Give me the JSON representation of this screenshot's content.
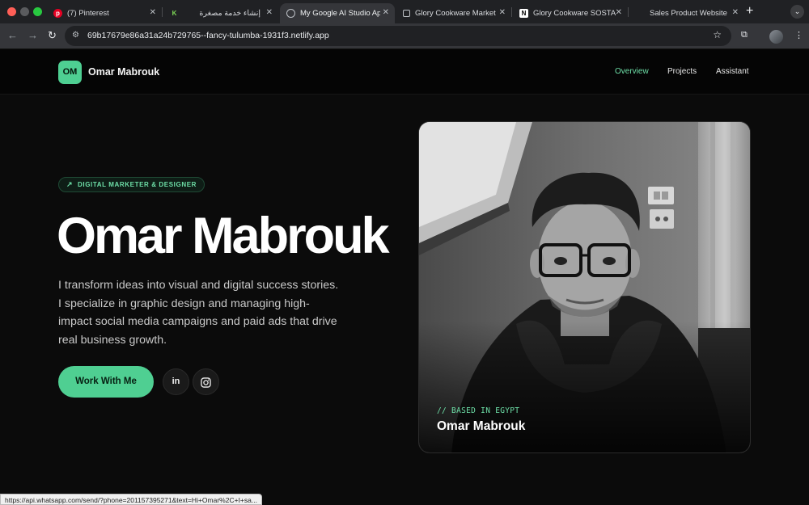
{
  "browser": {
    "tabs": [
      {
        "title": "(7) Pinterest",
        "icon": "pinterest-icon",
        "color": "#e60023"
      },
      {
        "title": "إنشاء خدمة مصغرة",
        "icon": "khamsat-icon",
        "color": "#7ed957"
      },
      {
        "title": "My Google AI Studio Ap",
        "icon": "globe-icon",
        "color": "#bdc1c6"
      },
      {
        "title": "Glory Cookware Market",
        "icon": "external-link-icon",
        "color": "#bdc1c6"
      },
      {
        "title": "Glory Cookware SOSTA",
        "icon": "notion-icon",
        "color": "#ffffff"
      },
      {
        "title": "Sales Product Website",
        "icon": "blank-icon",
        "color": "#202124"
      }
    ],
    "url": "69b17679e86a31a24b729765--fancy-tulumba-1931f3.netlify.app",
    "status_url": "https://api.whatsapp.com/send/?phone=201157395271&text=Hi+Omar%2C+I+sa..."
  },
  "site": {
    "logo_initials": "OM",
    "logo_name": "Omar Mabrouk",
    "nav": [
      "Overview",
      "Projects",
      "Assistant"
    ],
    "accent": "#4fcf92"
  },
  "hero": {
    "badge": "DIGITAL MARKETER & DESIGNER",
    "title": "Omar Mabrouk",
    "description": "I transform ideas into visual and digital success stories. I specialize in graphic design and managing high-impact social media campaigns and paid ads that drive real business growth.",
    "cta": "Work With Me",
    "social": [
      "linkedin-icon",
      "instagram-icon"
    ]
  },
  "photo": {
    "tag": "// BASED IN EGYPT",
    "name": "Omar Mabrouk"
  }
}
